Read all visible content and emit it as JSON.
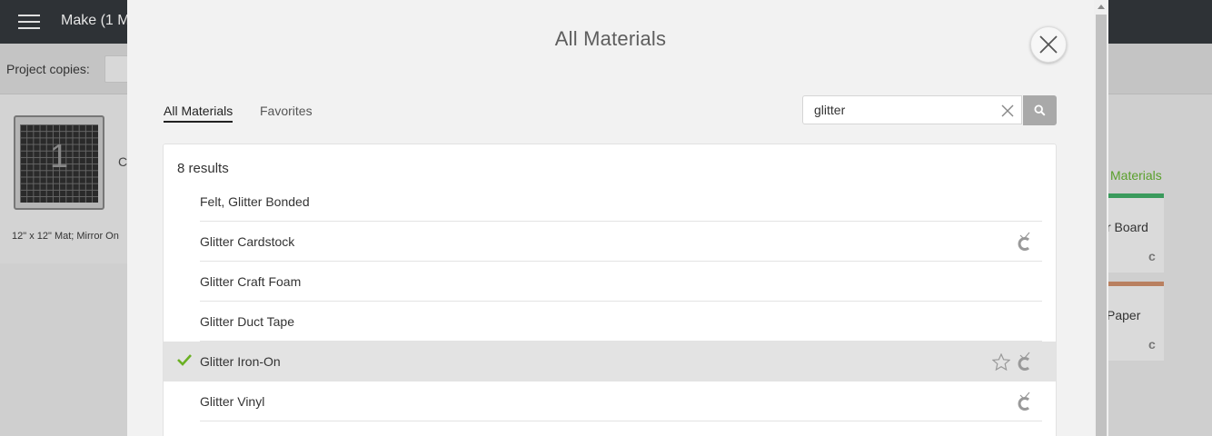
{
  "app": {
    "title": "Make (1 M",
    "project_copies_label": "Project copies:",
    "mat": {
      "number": "1",
      "caption": "12\" x 12\" Mat; Mirror On",
      "side_letter": "C"
    },
    "right_panel": {
      "link": "Materials",
      "card1_label": "r Board",
      "card2_label": "Paper"
    }
  },
  "modal": {
    "title": "All Materials",
    "tabs": [
      {
        "label": "All Materials",
        "active": true
      },
      {
        "label": "Favorites",
        "active": false
      }
    ],
    "search": {
      "value": "glitter",
      "placeholder": ""
    },
    "results_count": "8 results",
    "results": [
      {
        "label": "Felt, Glitter Bonded",
        "cricut": false,
        "selected": false,
        "star": false
      },
      {
        "label": "Glitter Cardstock",
        "cricut": true,
        "selected": false,
        "star": false
      },
      {
        "label": "Glitter Craft Foam",
        "cricut": false,
        "selected": false,
        "star": false
      },
      {
        "label": "Glitter Duct Tape",
        "cricut": false,
        "selected": false,
        "star": false
      },
      {
        "label": "Glitter Iron-On",
        "cricut": true,
        "selected": true,
        "star": true
      },
      {
        "label": "Glitter Vinyl",
        "cricut": true,
        "selected": false,
        "star": false
      }
    ]
  },
  "colors": {
    "accent_green": "#6ab023",
    "topbar": "#2e3236",
    "selected_row": "#e3e3e3"
  }
}
